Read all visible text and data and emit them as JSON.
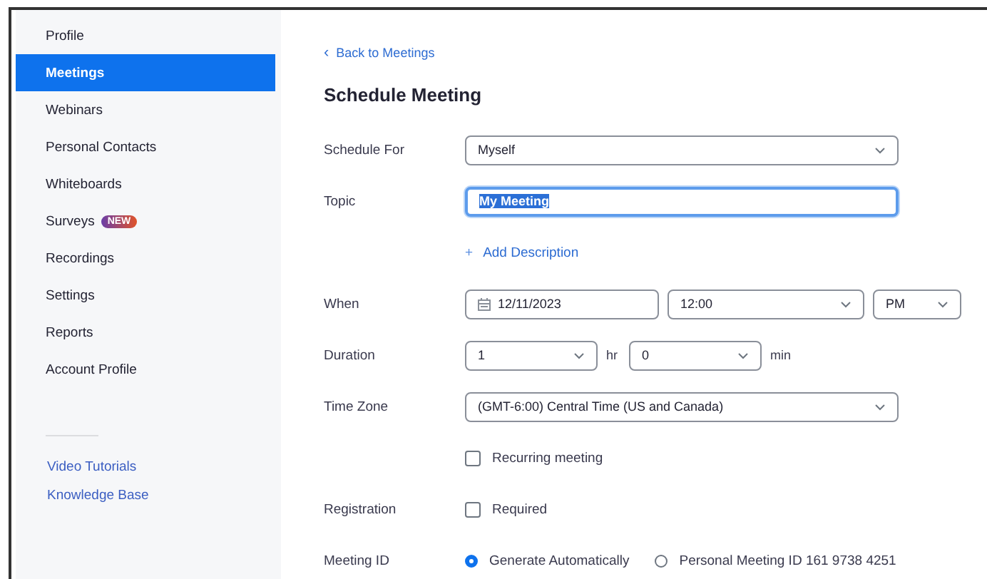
{
  "sidebar": {
    "items": [
      {
        "label": "Profile",
        "selected": false
      },
      {
        "label": "Meetings",
        "selected": true
      },
      {
        "label": "Webinars",
        "selected": false
      },
      {
        "label": "Personal Contacts",
        "selected": false
      },
      {
        "label": "Whiteboards",
        "selected": false
      },
      {
        "label": "Surveys",
        "selected": false,
        "badge": "NEW"
      },
      {
        "label": "Recordings",
        "selected": false
      },
      {
        "label": "Settings",
        "selected": false
      },
      {
        "label": "Reports",
        "selected": false
      },
      {
        "label": "Account Profile",
        "selected": false
      }
    ],
    "links": [
      "Video Tutorials",
      "Knowledge Base"
    ]
  },
  "back_link": {
    "icon": "‹",
    "text": "Back to Meetings"
  },
  "title": "Schedule Meeting",
  "rows": [
    {
      "kind": "select",
      "label": "Schedule For",
      "value": "Myself"
    },
    {
      "kind": "text",
      "label": "Topic",
      "value": "My Meeting",
      "focused": true
    },
    {
      "kind": "link",
      "icon": "+",
      "text": "Add Description"
    },
    {
      "kind": "when",
      "label": "When",
      "date": "12/11/2023",
      "time": "12:00",
      "period": "PM"
    },
    {
      "kind": "duration",
      "label": "Duration",
      "hours": "1",
      "hours_unit": "hr",
      "minutes": "0",
      "minutes_unit": "min"
    },
    {
      "kind": "select",
      "label": "Time Zone",
      "value": "(GMT-6:00) Central Time (US and Canada)"
    },
    {
      "kind": "checkbox",
      "text": "Recurring meeting",
      "checked": false
    },
    {
      "kind": "checkbox",
      "label": "Registration",
      "text": "Required",
      "checked": false
    },
    {
      "kind": "radio",
      "label": "Meeting ID",
      "options": [
        {
          "text": "Generate Automatically",
          "selected": true
        },
        {
          "text": "Personal Meeting ID 161 9738 4251",
          "selected": false
        }
      ]
    }
  ]
}
